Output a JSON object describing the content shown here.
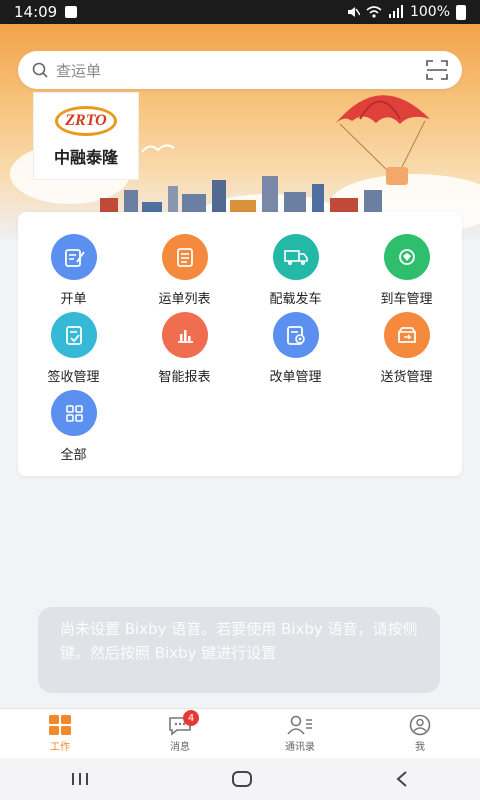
{
  "status_bar": {
    "time": "14:09",
    "battery": "100%"
  },
  "search": {
    "placeholder": "查运单"
  },
  "logo": {
    "mark": "ZRTO",
    "name": "中融泰隆"
  },
  "menu": [
    {
      "label": "开单",
      "color": "#5b8ff0",
      "icon": "edit-icon"
    },
    {
      "label": "运单列表",
      "color": "#f58a3e",
      "icon": "list-icon"
    },
    {
      "label": "配载发车",
      "color": "#23b9a6",
      "icon": "truck-icon"
    },
    {
      "label": "到车管理",
      "color": "#2fbf6c",
      "icon": "location-icon"
    },
    {
      "label": "签收管理",
      "color": "#36b9d6",
      "icon": "sign-icon"
    },
    {
      "label": "智能报表",
      "color": "#f06d50",
      "icon": "report-icon"
    },
    {
      "label": "改单管理",
      "color": "#5b8ff0",
      "icon": "modify-icon"
    },
    {
      "label": "送货管理",
      "color": "#f58a3e",
      "icon": "delivery-icon"
    },
    {
      "label": "全部",
      "color": "#5b8ff0",
      "icon": "grid-icon"
    }
  ],
  "toast": {
    "text": "尚未设置 Bixby 语音。若要使用 Bixby 语音，请按侧键。然后按照 Bixby 键进行设置"
  },
  "tabs": [
    {
      "label": "工作",
      "icon": "work-icon",
      "active": true
    },
    {
      "label": "消息",
      "icon": "message-icon",
      "badge": "4"
    },
    {
      "label": "通讯录",
      "icon": "contacts-icon"
    },
    {
      "label": "我",
      "icon": "profile-icon"
    }
  ],
  "colors": {
    "accent": "#f08a2b"
  }
}
